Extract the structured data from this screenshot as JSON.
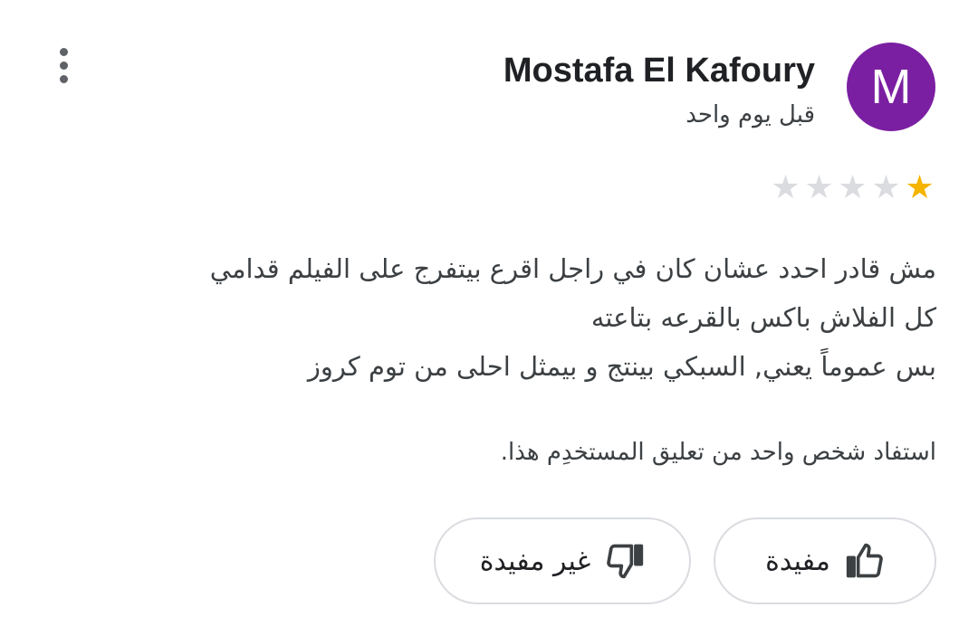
{
  "review": {
    "author": {
      "name": "Mostafa El Kafoury",
      "avatar_letter": "M",
      "avatar_color": "#7b1fa2"
    },
    "time": "قبل يوم واحد",
    "rating": {
      "value": 1,
      "max": 5
    },
    "body_lines": [
      "مش قادر احدد عشان كان في راجل اقرع بيتفرج على الفيلم قدامي",
      "كل الفلاش باكس بالقرعه بتاعته",
      "بس عموماً يعني, السبكي بينتج و بيمثل احلى من توم كروز"
    ],
    "helpful_text": "استفاد شخص واحد من تعليق المستخدِم هذا.",
    "actions": {
      "helpful_label": "مفيدة",
      "not_helpful_label": "غير مفيدة"
    },
    "icons": {
      "menu": "more-vertical-icon",
      "helpful": "thumb-up-icon",
      "not_helpful": "thumb-down-icon",
      "star": "star-icon"
    },
    "colors": {
      "star_filled": "#f4b400",
      "star_empty": "#dadce0",
      "border": "#dadce0"
    }
  }
}
